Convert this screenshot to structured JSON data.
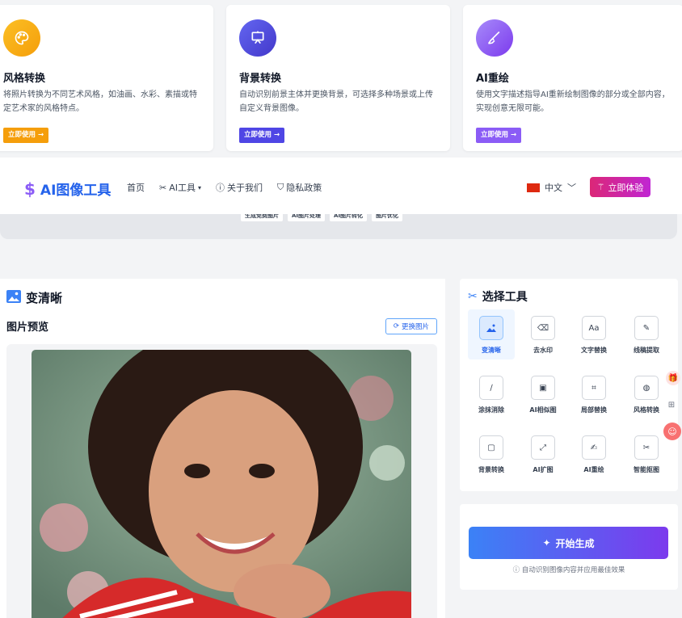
{
  "cards": [
    {
      "title": "风格转换",
      "desc": "将照片转换为不同艺术风格，如油画、水彩、素描或特定艺术家的风格特点。",
      "button": "立即使用 →",
      "icon": "palette-icon",
      "color": "#f59e0b"
    },
    {
      "title": "背景转换",
      "desc": "自动识别前景主体并更换背景，可选择多种场景或上传自定义背景图像。",
      "button": "立即使用 →",
      "icon": "easel-icon",
      "color": "#4f46e5"
    },
    {
      "title": "AI重绘",
      "desc": "使用文字描述指导AI重新绘制图像的部分或全部内容，实现创意无限可能。",
      "button": "立即使用 →",
      "icon": "brush-icon",
      "color": "#8b5cf6"
    }
  ],
  "nav": {
    "logo": "AI图像工具",
    "links": {
      "home": "首页",
      "ai_tools": "AI工具",
      "about": "关于我们",
      "privacy": "隐私政策"
    },
    "lang": "中文",
    "cta": "立即体验"
  },
  "tags": [
    "生成免费图片",
    "AI图片处理",
    "AI图片转化",
    "图片优化"
  ],
  "main": {
    "title": "变清晰",
    "preview_label": "图片预览",
    "swap_button": "更换图片"
  },
  "tools": {
    "heading": "选择工具",
    "items": [
      {
        "label": "变清晰",
        "icon": "mountain-image-icon",
        "selected": true
      },
      {
        "label": "去水印",
        "icon": "eraser-icon"
      },
      {
        "label": "文字替换",
        "icon": "text-aa-icon",
        "glyph": "Aa"
      },
      {
        "label": "线稿提取",
        "icon": "pencil-icon"
      },
      {
        "label": "涂抹消除",
        "icon": "smudge-icon"
      },
      {
        "label": "AI相似图",
        "icon": "gallery-icon"
      },
      {
        "label": "局部替换",
        "icon": "crop-icon"
      },
      {
        "label": "风格转换",
        "icon": "palette-icon"
      },
      {
        "label": "背景转换",
        "icon": "frame-icon"
      },
      {
        "label": "AI扩图",
        "icon": "expand-icon"
      },
      {
        "label": "AI重绘",
        "icon": "edit-icon"
      },
      {
        "label": "智能抠图",
        "icon": "scissors-icon"
      }
    ]
  },
  "generate": {
    "button": "开始生成",
    "hint": "自动识别图像内容并应用最佳效果"
  }
}
